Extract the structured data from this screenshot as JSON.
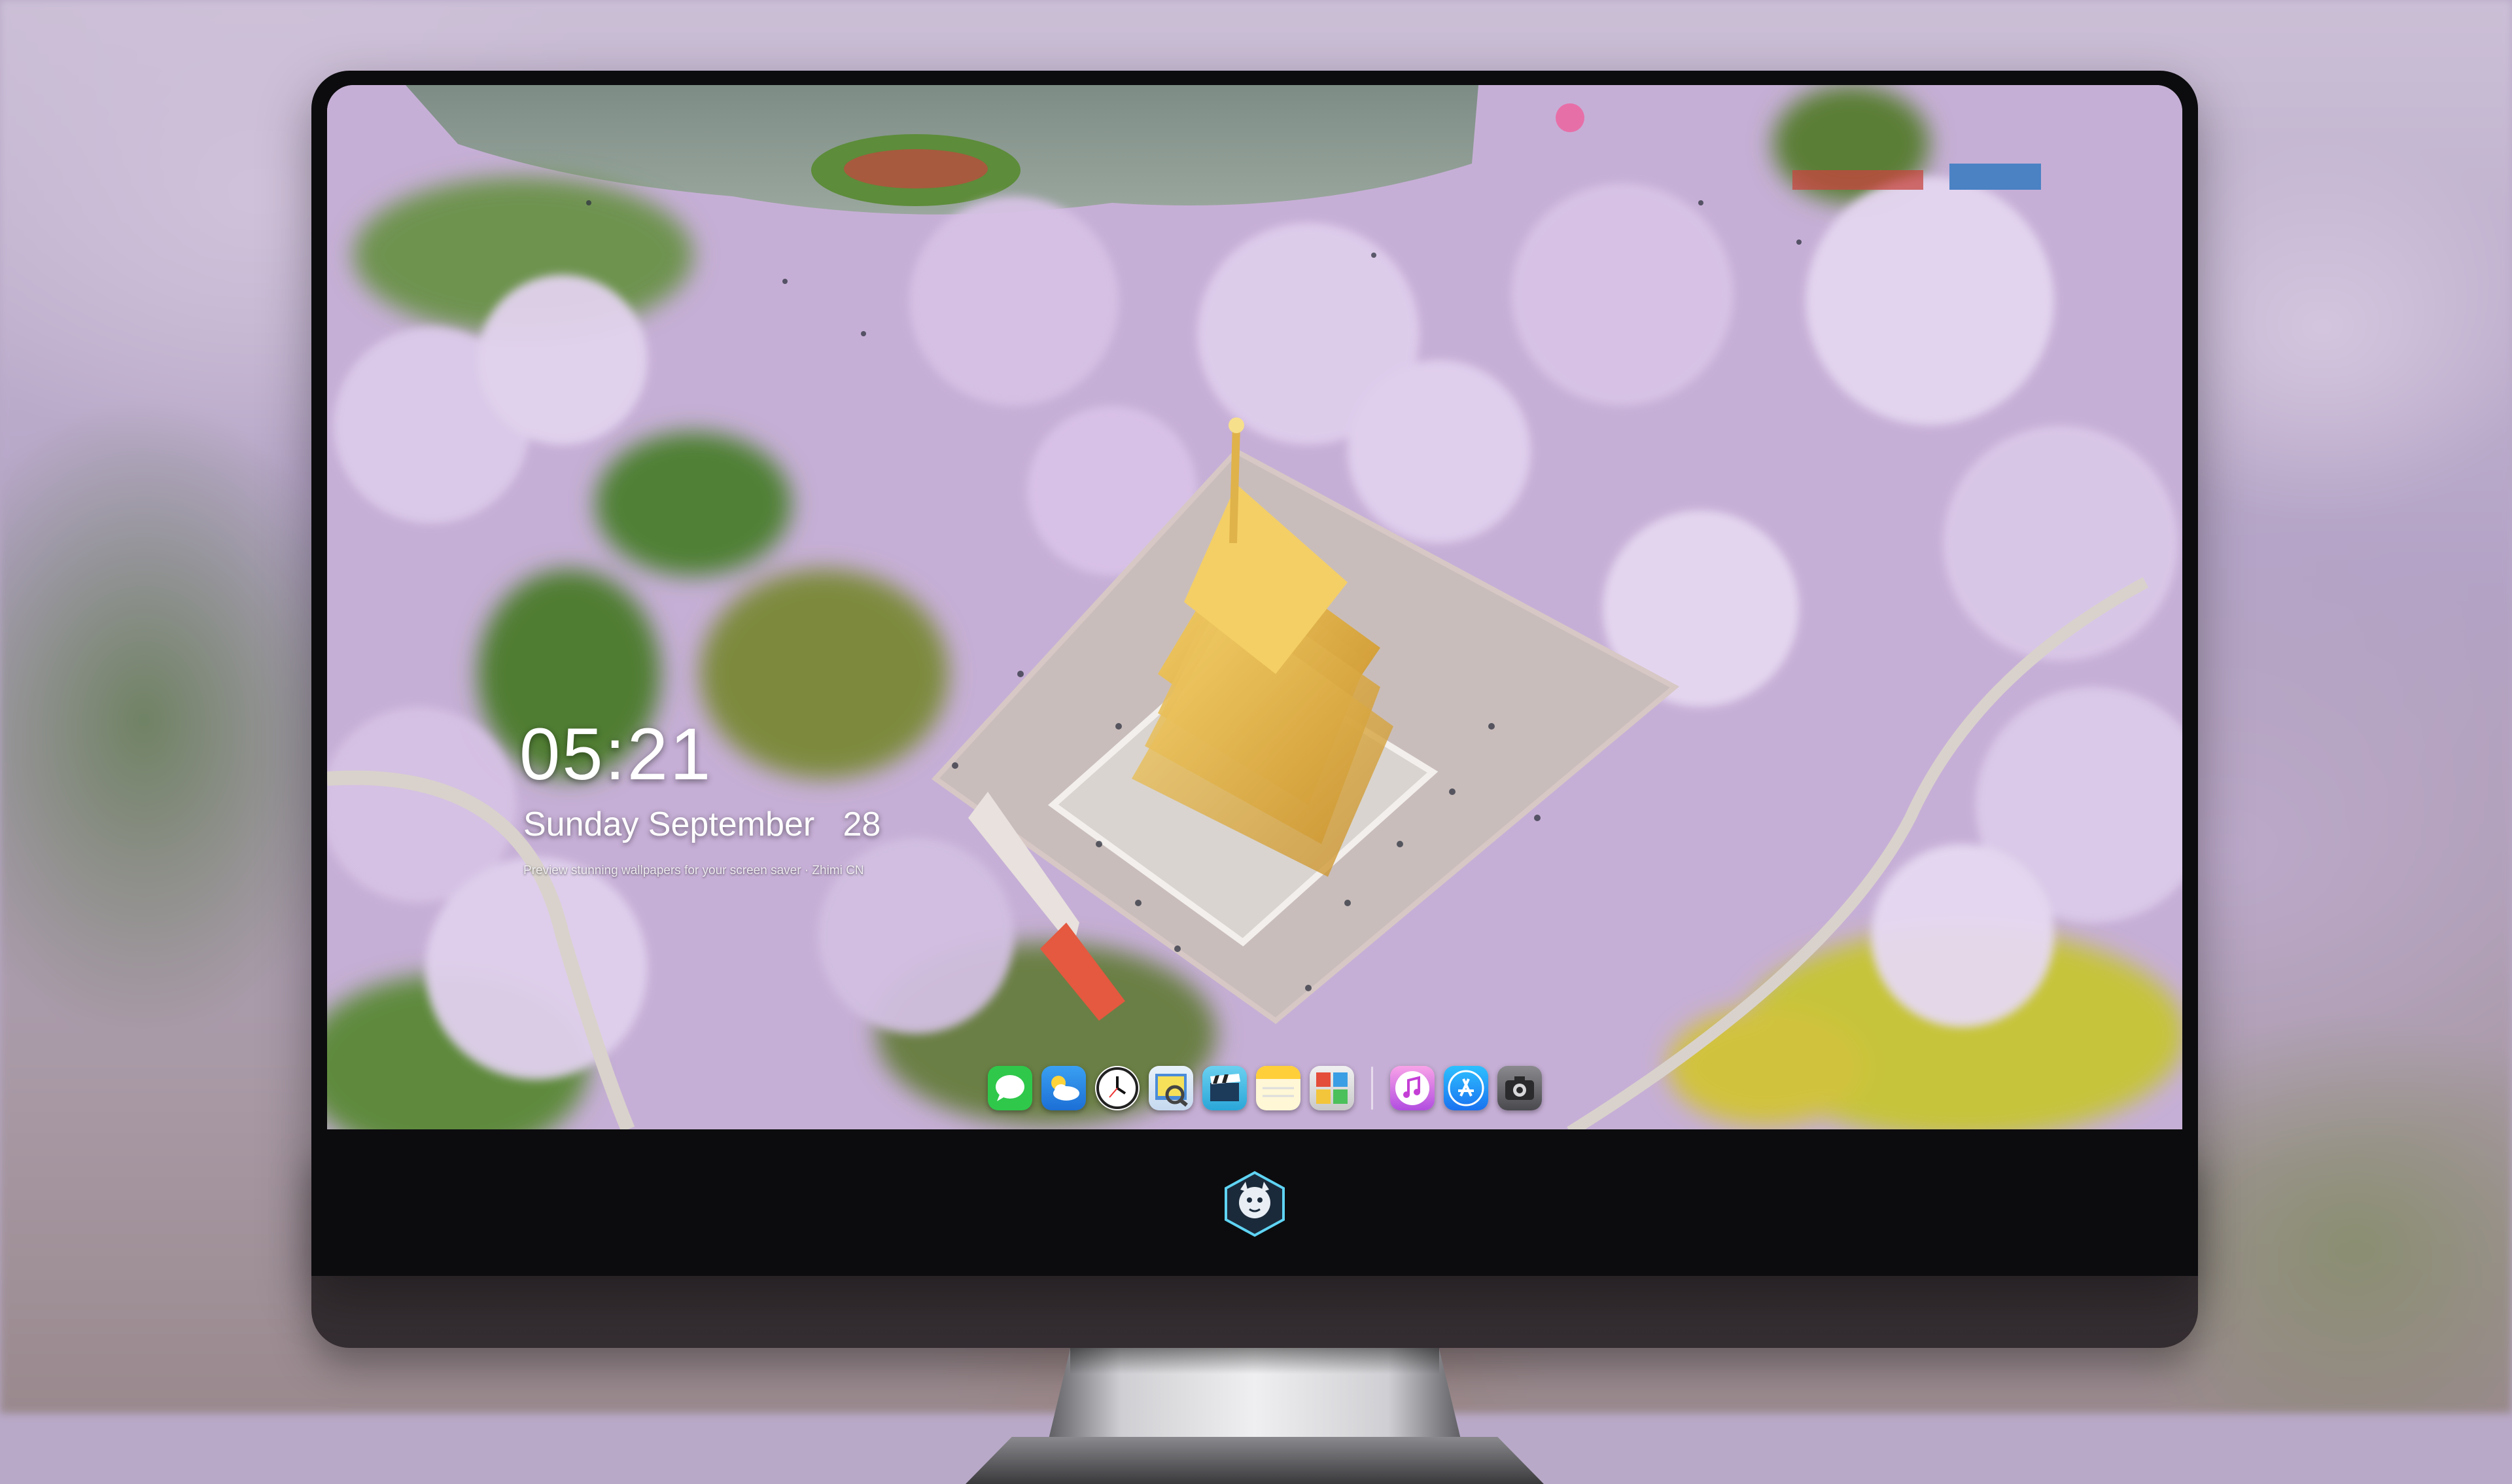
{
  "lock_screen": {
    "time": "05:21",
    "date": "Sunday September   28",
    "hint": "Preview stunning wallpapers for your screen saver · Zhimi CN"
  },
  "dock": {
    "apps": [
      {
        "name": "Messages",
        "icon": "messages-icon"
      },
      {
        "name": "Weather",
        "icon": "weather-icon"
      },
      {
        "name": "Clock",
        "icon": "clock-icon"
      },
      {
        "name": "Preview",
        "icon": "preview-icon"
      },
      {
        "name": "Clips",
        "icon": "clips-icon"
      },
      {
        "name": "Notes",
        "icon": "notes-icon"
      },
      {
        "name": "Photo Booth",
        "icon": "photo-booth-icon"
      },
      {
        "name": "iTunes",
        "icon": "itunes-icon"
      },
      {
        "name": "App Store",
        "icon": "app-store-icon"
      },
      {
        "name": "Screenshot",
        "icon": "screenshot-icon"
      }
    ]
  },
  "colors": {
    "bezel": "#0c0c0e",
    "chin": "#3b3437",
    "blossom": "#d8c5e6",
    "pagoda": "#e8b94a",
    "foliage": "#5f8a3c"
  }
}
